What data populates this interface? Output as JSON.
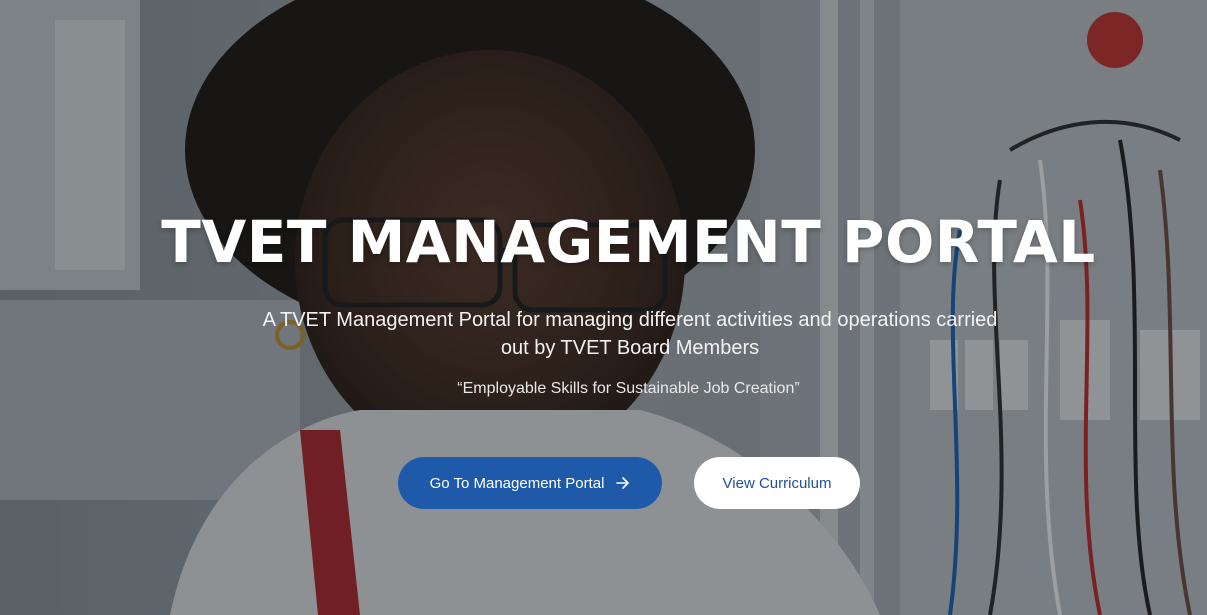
{
  "hero": {
    "title": "TVET MANAGEMENT PORTAL",
    "subtitle": "A TVET Management Portal for managing different activities and operations carried out by TVET Board Members",
    "tagline": "“Employable Skills for Sustainable Job Creation”",
    "primary_button": {
      "label": "Go To Management Portal",
      "icon": "arrow-right-icon"
    },
    "secondary_button": {
      "label": "View Curriculum"
    },
    "background_image": "student-with-glasses-at-electrical-lab-workbench"
  },
  "colors": {
    "primary": "#1f5aaa",
    "secondary_text": "#1f4f9a",
    "title_text": "#ffffff"
  }
}
